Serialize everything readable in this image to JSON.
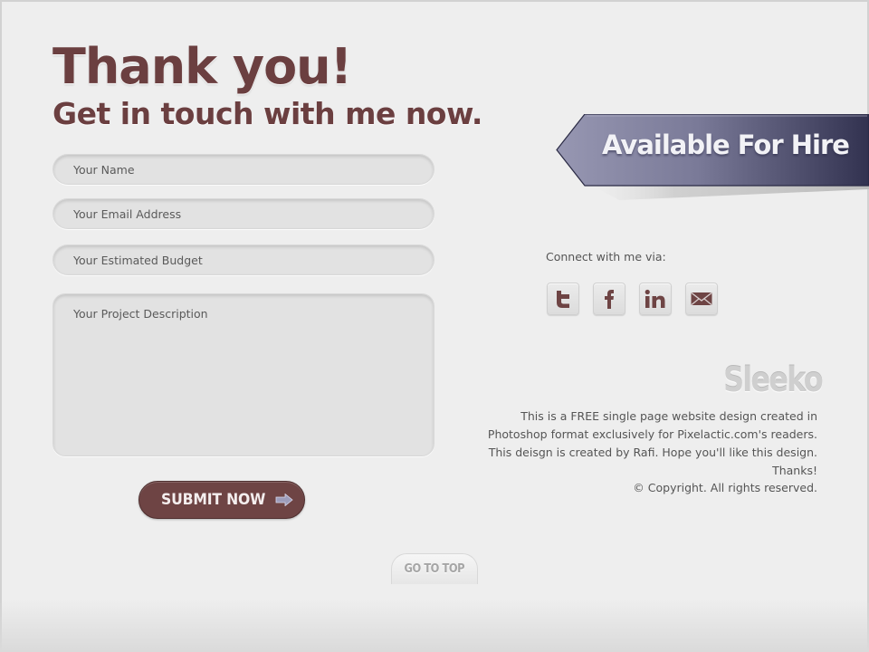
{
  "header": {
    "title": "Thank you!",
    "subtitle": "Get in touch with me now."
  },
  "form": {
    "name_placeholder": "Your Name",
    "email_placeholder": "Your Email Address",
    "budget_placeholder": "Your Estimated Budget",
    "description_placeholder": "Your Project Description",
    "submit_label": "SUBMIT NOW"
  },
  "ribbon": {
    "label": "Available For Hire"
  },
  "social": {
    "label": "Connect with me via:",
    "icons": [
      "twitter-icon",
      "facebook-icon",
      "linkedin-icon",
      "email-icon"
    ]
  },
  "footer": {
    "logo": "Sleeko",
    "description": "This is a FREE single page website design created in Photoshop format exclusively for Pixelactic.com's readers. This deisgn is created by Rafi. Hope you'll like this design. Thanks!",
    "copyright": "© Copyright. All rights reserved.",
    "go_to_top": "GO TO TOP"
  },
  "colors": {
    "brand": "#6b3f40",
    "ribbon_dark": "#3b3b57",
    "ribbon_light": "#8f8fab",
    "background": "#eeeeee"
  }
}
